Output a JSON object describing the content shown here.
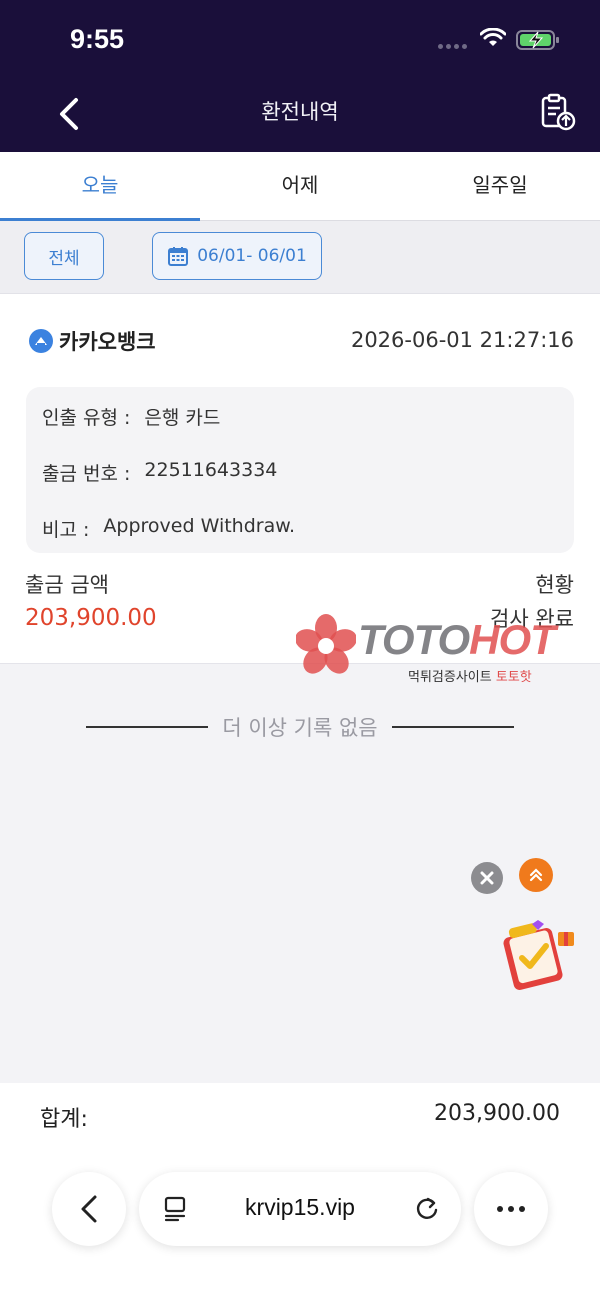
{
  "status_bar": {
    "time": "9:55"
  },
  "header": {
    "title": "환전내역"
  },
  "tabs": [
    {
      "label": "오늘",
      "active": true
    },
    {
      "label": "어제",
      "active": false
    },
    {
      "label": "일주일",
      "active": false
    }
  ],
  "filters": {
    "all_label": "전체",
    "date_range": "06/01- 06/01"
  },
  "record": {
    "bank_name": "카카오뱅크",
    "datetime": "2026-06-01 21:27:16",
    "withdraw_type_label": "인출 유형 :",
    "withdraw_type_value": "은행 카드",
    "withdraw_no_label": "출금 번호 :",
    "withdraw_no_value": "22511643334",
    "note_label": "비고 :",
    "note_value": "Approved Withdraw.",
    "amount_label": "출금 금액",
    "amount_value": "203,900.00",
    "status_label": "현황",
    "status_value": "검사 완료"
  },
  "watermark": {
    "brand_a": "TOTO",
    "brand_b": "HOT",
    "sub_a": "먹튀검증사이트 ",
    "sub_b": "토토핫"
  },
  "list_end": "더 이상 기록 없음",
  "footer": {
    "total_label": "합계:",
    "total_value": "203,900.00"
  },
  "browser": {
    "url": "krvip15.vip"
  },
  "colors": {
    "nav_bg": "#1a0f3a",
    "accent": "#3c7fd1",
    "amount": "#e0442c"
  }
}
